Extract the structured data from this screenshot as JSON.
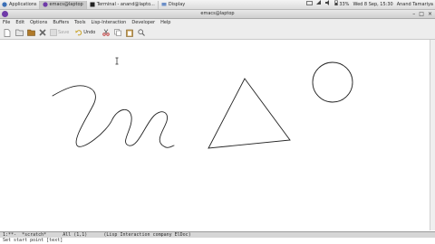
{
  "panel": {
    "applications": "Applications",
    "tasks": [
      {
        "label": "emacs@laptop"
      },
      {
        "label": "Terminal - anand@lapto..."
      },
      {
        "label": "Display"
      }
    ],
    "battery": "33%",
    "datetime": "Wed 8 Sep, 15:30",
    "user": "Anand Tamariya"
  },
  "window": {
    "title": "emacs@laptop"
  },
  "menu": [
    "File",
    "Edit",
    "Options",
    "Buffers",
    "Tools",
    "Lisp-Interaction",
    "Developer",
    "Help"
  ],
  "toolbar": {
    "save_label": "Save",
    "undo_label": "Undo"
  },
  "modeline": {
    "text": "1:**-  *scratch*      All (1,1)      (Lisp Interaction company ElDoc)"
  },
  "minibuffer": {
    "text": "Set start point [text]"
  },
  "colors": {
    "panel": "#dcdcdc",
    "menubar": "#ededed",
    "modeline": "#d6d6d6",
    "emacs_icon": "#6f3aa8",
    "stroke": "#222222"
  }
}
